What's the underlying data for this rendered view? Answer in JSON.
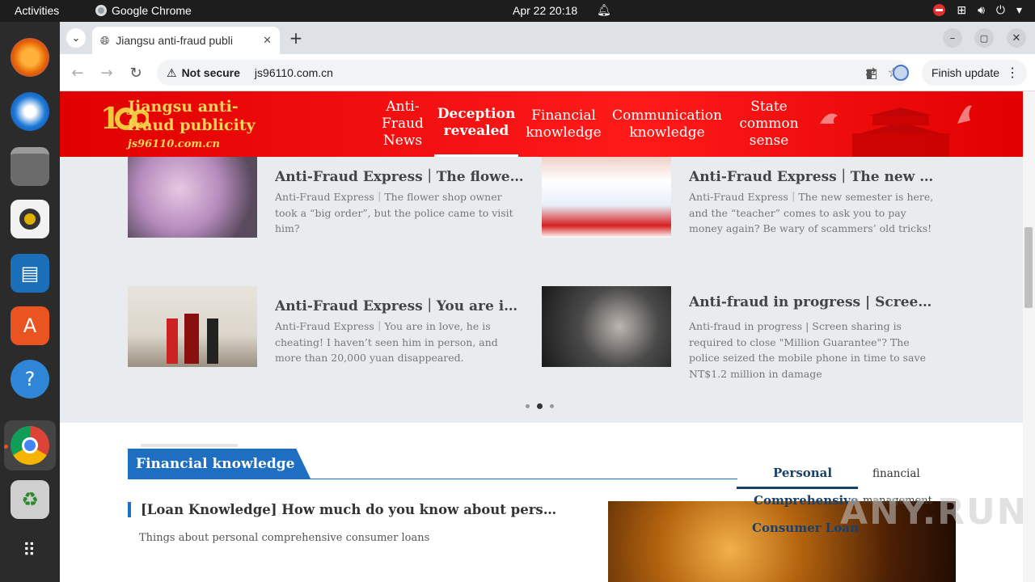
{
  "os": {
    "activities": "Activities",
    "app_name": "Google Chrome",
    "clock": "Apr 22  20:18"
  },
  "browser": {
    "tab_title": "Jiangsu anti-fraud publi",
    "security_label": "Not secure",
    "url": "js96110.com.cn",
    "update_button": "Finish update"
  },
  "site": {
    "brand_name": "Jiangsu anti-fraud publicity",
    "brand_url": "js96110.com.cn",
    "nav": [
      {
        "label": "Anti-Fraud News"
      },
      {
        "label": "Deception revealed"
      },
      {
        "label": "Financial knowledge"
      },
      {
        "label": "Communication knowledge"
      },
      {
        "label": "State common sense"
      }
    ]
  },
  "cards": [
    {
      "title": "Anti-Fraud Express｜The flower sho…",
      "desc": "Anti-Fraud Express｜The flower shop owner took a “big order”, but the police came to visit him?"
    },
    {
      "title": "Anti-Fraud Express｜The new semes…",
      "desc": "Anti-Fraud Express｜The new semester is here, and the “teacher” comes to ask you to pay money again? Be wary of scammers’ old tricks!"
    },
    {
      "title": "Anti-Fraud Express｜You are in love,…",
      "desc": "Anti-Fraud Express｜You are in love, he is cheating! I haven’t seen him in person, and more than 20,000 yuan disappeared."
    },
    {
      "title": "Anti-fraud in progress | Screen sharin…",
      "desc": "Anti-fraud in progress | Screen sharing is required to close \"Million Guarantee\"? The police seized the mobile phone in time to save NT$1.2 million in damage"
    }
  ],
  "carousel": {
    "pages": 3,
    "active": 2
  },
  "financial": {
    "section_title": "Financial knowledge",
    "article_title": "[Loan Knowledge] How much do you know about personal comp…",
    "article_desc": "Things about personal comprehensive consumer loans",
    "right_tabs": {
      "tab1_line1": "Personal",
      "tab1_line2": "Comprehensive",
      "tab1_line3": "Consumer Loan",
      "tab2_line1": "financial",
      "tab2_line2": "management"
    }
  },
  "watermark": "ANY.RUN"
}
